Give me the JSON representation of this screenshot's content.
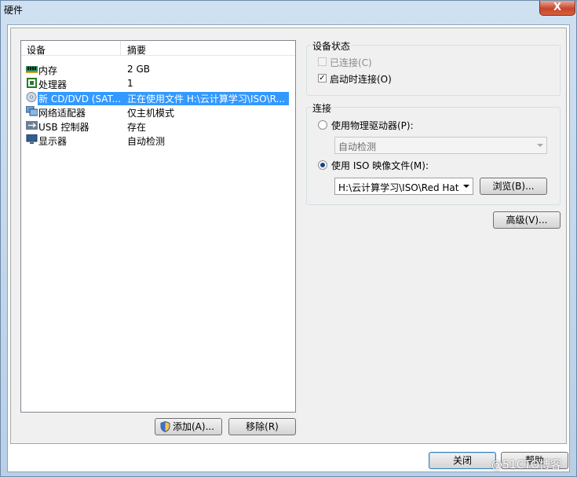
{
  "window": {
    "title": "硬件",
    "close_label": "X"
  },
  "list": {
    "headers": [
      "设备",
      "摘要"
    ],
    "rows": [
      {
        "device": "内存",
        "summary": "2 GB",
        "icon": "memory-icon"
      },
      {
        "device": "处理器",
        "summary": "1",
        "icon": "processor-icon"
      },
      {
        "device": "新 CD/DVD (SAT...",
        "summary": "正在使用文件 H:\\云计算学习\\ISO\\R...",
        "icon": "cd-dvd-icon"
      },
      {
        "device": "网络适配器",
        "summary": "仅主机模式",
        "icon": "network-adapter-icon"
      },
      {
        "device": "USB 控制器",
        "summary": "存在",
        "icon": "usb-icon"
      },
      {
        "device": "显示器",
        "summary": "自动检测",
        "icon": "display-icon"
      }
    ],
    "selected_index": 2
  },
  "buttons": {
    "add": "添加(A)...",
    "remove": "移除(R)",
    "close": "关闭",
    "help": "帮助",
    "browse": "浏览(B)...",
    "advanced": "高级(V)..."
  },
  "device_status": {
    "title": "设备状态",
    "connected": {
      "label": "已连接(C)",
      "checked": false,
      "disabled": true
    },
    "connect_at_power_on": {
      "label": "启动时连接(O)",
      "checked": true
    }
  },
  "connection": {
    "title": "连接",
    "physical": {
      "label": "使用物理驱动器(P):",
      "selected": false
    },
    "physical_combo_value": "自动检测",
    "iso": {
      "label": "使用 ISO 映像文件(M):",
      "selected": true
    },
    "iso_path": "H:\\云计算学习\\ISO\\Red Hat"
  },
  "watermark": "@51CTO博客",
  "colors": {
    "selection": "#3399ff"
  }
}
